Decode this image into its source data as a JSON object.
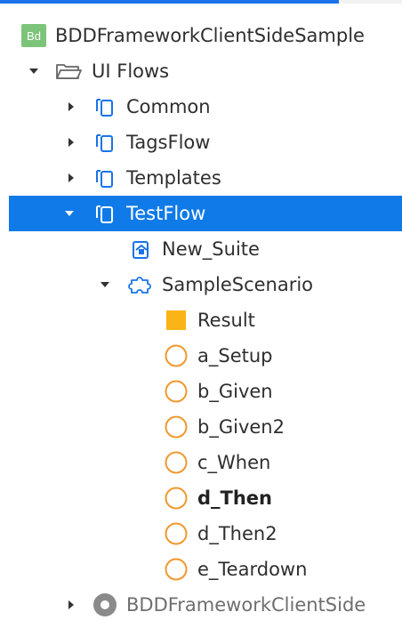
{
  "colors": {
    "accent": "#0f7ae8",
    "icon_blue": "#1a73e8",
    "icon_orange": "#f0982e",
    "result_yellow": "#fbb417",
    "project_green": "#7cc47a",
    "disabled_gray": "#8a8a8a"
  },
  "tree": {
    "project": {
      "label": "BDDFrameworkClientSideSample",
      "badge": "Bd",
      "icon": "project-badge-icon"
    },
    "ui_flows": {
      "label": "UI Flows",
      "icon": "folder-open-icon",
      "expanded": true
    },
    "flows": [
      {
        "label": "Common",
        "icon": "mobile-flow-icon",
        "expanded": false
      },
      {
        "label": "TagsFlow",
        "icon": "mobile-flow-icon",
        "expanded": false
      },
      {
        "label": "Templates",
        "icon": "mobile-flow-icon",
        "expanded": false
      },
      {
        "label": "TestFlow",
        "icon": "mobile-flow-icon",
        "expanded": true,
        "selected": true
      }
    ],
    "screen": {
      "label": "New_Suite",
      "icon": "home-screen-icon"
    },
    "block": {
      "label": "SampleScenario",
      "icon": "puzzle-block-icon",
      "expanded": true
    },
    "block_items": [
      {
        "label": "Result",
        "icon": "output-square-icon",
        "bold": false
      },
      {
        "label": "a_Setup",
        "icon": "circle-placeholder-icon",
        "bold": false
      },
      {
        "label": "b_Given",
        "icon": "circle-placeholder-icon",
        "bold": false
      },
      {
        "label": "b_Given2",
        "icon": "circle-placeholder-icon",
        "bold": false
      },
      {
        "label": "c_When",
        "icon": "circle-placeholder-icon",
        "bold": false
      },
      {
        "label": "d_Then",
        "icon": "circle-placeholder-icon",
        "bold": true
      },
      {
        "label": "d_Then2",
        "icon": "circle-placeholder-icon",
        "bold": false
      },
      {
        "label": "e_Teardown",
        "icon": "circle-placeholder-icon",
        "bold": false
      }
    ],
    "dependency": {
      "label": "BDDFrameworkClientSide",
      "icon": "module-reference-icon",
      "expanded": false
    }
  }
}
